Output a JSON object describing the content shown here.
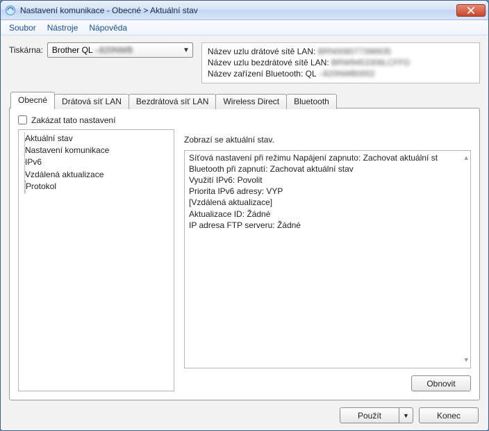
{
  "window": {
    "title": "Nastavení komunikace - Obecné > Aktuální stav"
  },
  "menu": {
    "file": "Soubor",
    "tools": "Nástroje",
    "help": "Nápověda"
  },
  "printer": {
    "label": "Tiskárna:",
    "value_prefix": "Brother QL",
    "value_blur": "–820NWB"
  },
  "info": {
    "wired_label": "Název uzlu drátové sítě LAN:",
    "wired_blur": "BRN008077398935",
    "wireless_label": "Název uzlu bezdrátové sítě LAN:",
    "wireless_blur": "BRW9453306LCFFD",
    "bt_label": "Název zařízení Bluetooth:",
    "bt_prefix": "QL",
    "bt_blur": "–820NWB0002"
  },
  "tabs": {
    "general": "Obecné",
    "wired": "Drátová síť LAN",
    "wireless": "Bezdrátová síť LAN",
    "wdirect": "Wireless Direct",
    "bluetooth": "Bluetooth"
  },
  "disable": {
    "label": "Zakázat tato nastavení"
  },
  "tree": {
    "n0": "Aktuální stav",
    "n1": "Nastavení komunikace",
    "n2": "IPv6",
    "n3": "Vzdálená aktualizace",
    "n3_0": "Protokol"
  },
  "right": {
    "title": "Zobrazí se aktuální stav.",
    "l0": "Síťová nastavení při režimu Napájení zapnuto: Zachovat aktuální st",
    "l1": "Bluetooth při zapnutí: Zachovat aktuální stav",
    "l2": "Využití IPv6: Povolit",
    "l3": "Priorita IPv6 adresy: VYP",
    "l4": "[Vzdálená aktualizace]",
    "l5": "Aktualizace ID: Žádné",
    "l6": "IP adresa FTP serveru: Žádné"
  },
  "buttons": {
    "refresh": "Obnovit",
    "apply": "Použít",
    "close": "Konec"
  }
}
